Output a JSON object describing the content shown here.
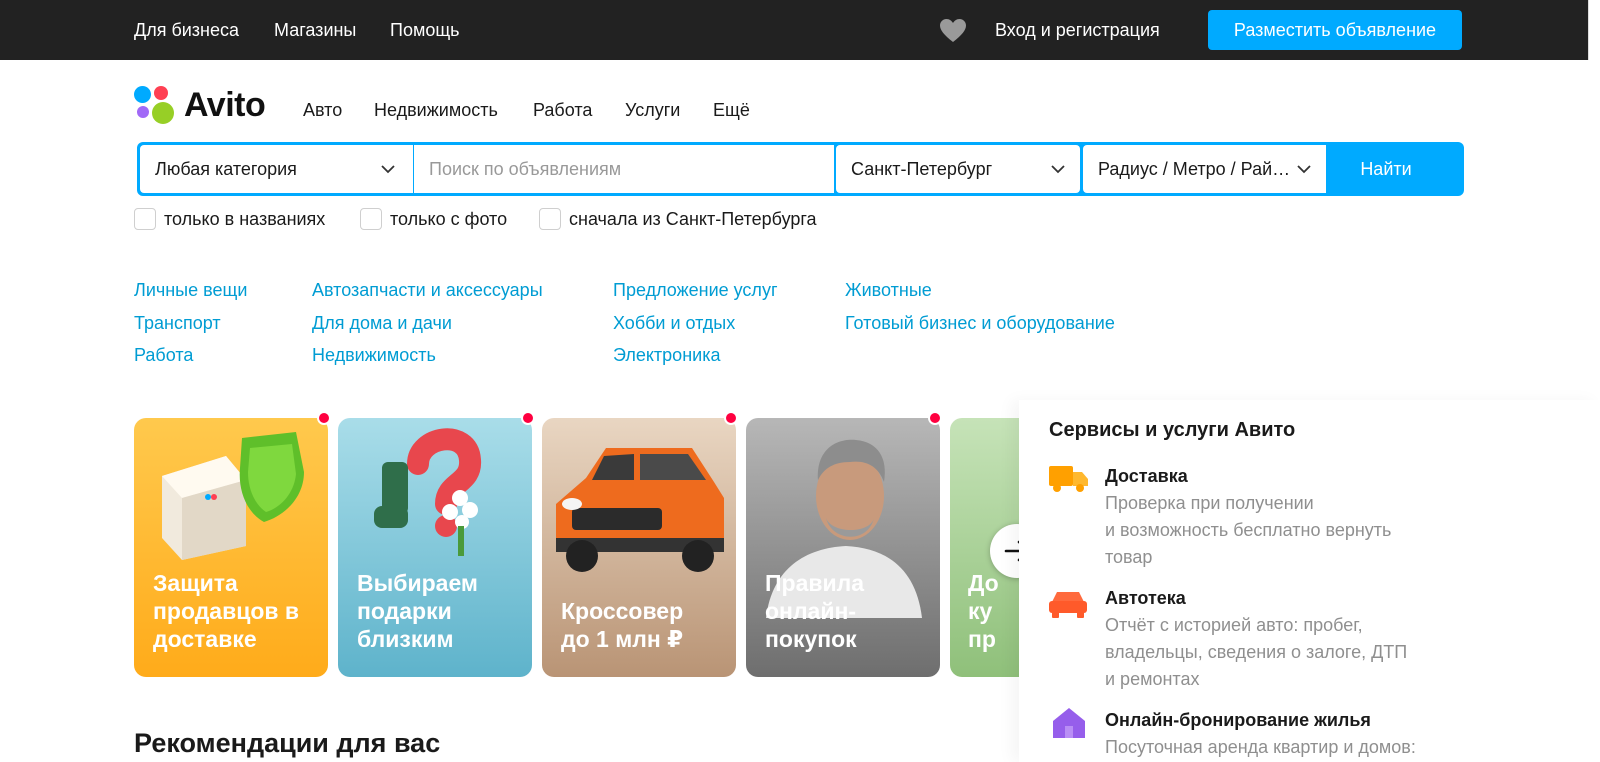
{
  "topbar": {
    "links": [
      "Для бизнеса",
      "Магазины",
      "Помощь"
    ],
    "login": "Вход и регистрация",
    "post_ad": "Разместить объявление",
    "favorites_icon": "heart-icon"
  },
  "logo": {
    "text": "Avito",
    "colors": [
      "#00aaff",
      "#ff4053",
      "#97cf26",
      "#a169f7"
    ]
  },
  "nav": [
    "Авто",
    "Недвижимость",
    "Работа",
    "Услуги",
    "Ещё"
  ],
  "search": {
    "category": "Любая категория",
    "placeholder": "Поиск по объявлениям",
    "city": "Санкт-Петербург",
    "radius": "Радиус / Метро / Рай…",
    "find": "Найти"
  },
  "filters": [
    "только в названиях",
    "только с фото",
    "сначала из Санкт-Петербурга"
  ],
  "categories": [
    [
      "Личные вещи",
      "Транспорт",
      "Работа"
    ],
    [
      "Автозапчасти и аксессуары",
      "Для дома и дачи",
      "Недвижимость"
    ],
    [
      "Предложение услуг",
      "Хобби и отдых",
      "Электроника"
    ],
    [
      "Животные",
      "Готовый бизнес и оборудование"
    ]
  ],
  "stories": [
    {
      "title": "Защита\nпродавцов в\nдоставке",
      "color": "#ffb020"
    },
    {
      "title": "Выбираем\nподарки\nблизким",
      "color": "#6fc0da"
    },
    {
      "title": "Кроссовер\nдо 1 млн ₽",
      "color": "#c9a98c"
    },
    {
      "title": "Правила\nонлайн-\nпокупок",
      "color": "#8a8a8a"
    },
    {
      "title": "До\nку\nпр",
      "color": "#9ccc8a"
    }
  ],
  "services": {
    "heading": "Сервисы и услуги Авито",
    "items": [
      {
        "title": "Доставка",
        "desc": "Проверка при получении\nи возможность бесплатно вернуть\nтовар",
        "icon": "truck-icon"
      },
      {
        "title": "Автотека",
        "desc": "Отчёт с историей авто: пробег,\nвладельцы, сведения о залоге, ДТП\nи ремонтах",
        "icon": "car-icon"
      },
      {
        "title": "Онлайн-бронирование жилья",
        "desc": "Посуточная аренда квартир и домов:",
        "icon": "house-icon"
      }
    ]
  },
  "recommendations": "Рекомендации для вас"
}
